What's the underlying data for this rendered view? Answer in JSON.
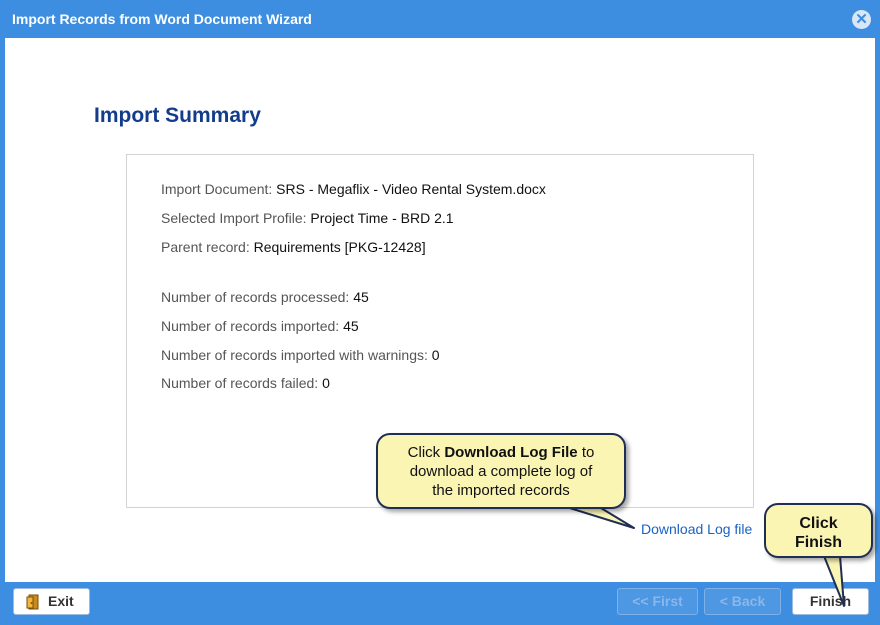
{
  "window": {
    "title": "Import Records from Word Document Wizard",
    "close_icon": "close-icon"
  },
  "main": {
    "heading": "Import Summary",
    "summary": {
      "import_document_label": "Import Document:",
      "import_document_value": "SRS - Megaflix - Video Rental System.docx",
      "profile_label": "Selected Import Profile:",
      "profile_value": "Project Time - BRD 2.1",
      "parent_label": "Parent record:",
      "parent_value": "Requirements [PKG-12428]",
      "processed_label": "Number of records processed:",
      "processed_value": "45",
      "imported_label": "Number of records imported:",
      "imported_value": "45",
      "warnings_label": "Number of records imported with warnings:",
      "warnings_value": "0",
      "failed_label": "Number of records failed:",
      "failed_value": "0"
    },
    "download_link": "Download Log file"
  },
  "callouts": {
    "download_prefix": "Click ",
    "download_bold": "Download Log File",
    "download_suffix": " to",
    "download_line2": "download a complete log of",
    "download_line3": "the imported records",
    "finish_line1": "Click",
    "finish_line2": "Finish"
  },
  "footer": {
    "exit_label": "Exit",
    "first_label": "<< First",
    "back_label": "< Back",
    "finish_label": "Finish"
  },
  "colors": {
    "accent": "#3d8ee0",
    "heading": "#133d8c",
    "link": "#1a62c4",
    "callout_fill": "#fbf5b4"
  }
}
